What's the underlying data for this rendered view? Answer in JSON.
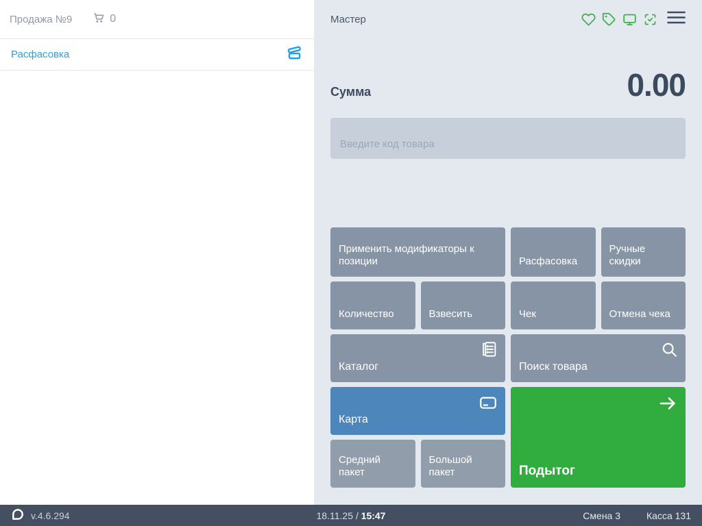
{
  "colors": {
    "panel_bg": "#e4e9f0",
    "statusbar_bg": "#444f61",
    "button_gray": "#8694a5",
    "bag_gray": "#929dab",
    "card_blue": "#4c86bb",
    "subtotal_green": "#31ac3e",
    "link_blue": "#2d9fe8",
    "status_icon_green": "#3fae4c"
  },
  "left_panel": {
    "sale_title": "Продажа №9",
    "cart_icon": "cart-icon",
    "cart_count": "0",
    "items": [
      {
        "label": "Расфасовка",
        "icon": "open-box-icon"
      }
    ]
  },
  "header": {
    "user_label": "Мастер",
    "status_icons": [
      "heart-icon",
      "tag-icon",
      "display-icon",
      "scan-check-icon"
    ],
    "menu_icon": "menu-icon"
  },
  "sum": {
    "label": "Сумма",
    "value": "0.00"
  },
  "code_input": {
    "placeholder": "Введите код товара",
    "value": ""
  },
  "keypad": [
    {
      "label": "Применить модификаторы к позиции"
    },
    {
      "label": "Расфасовка"
    },
    {
      "label": "Ручные скидки"
    },
    {
      "label": "Количество"
    },
    {
      "label": "Взвесить"
    },
    {
      "label": "Чек"
    },
    {
      "label": "Отмена чека"
    },
    {
      "label": "Каталог",
      "icon": "catalog-icon"
    },
    {
      "label": "Поиск товара",
      "icon": "search-icon"
    },
    {
      "label": "Карта",
      "icon": "card-icon"
    },
    {
      "label": "Средний пакет"
    },
    {
      "label": "Большой пакет"
    },
    {
      "label": "Подытог",
      "icon": "arrow-right-icon"
    }
  ],
  "status_bar": {
    "logo": "brand-logo",
    "version": "v.4.6.294",
    "date": "18.11.25",
    "separator": "/",
    "time": "15:47",
    "shift": "Смена 3",
    "register": "Касса 131"
  }
}
